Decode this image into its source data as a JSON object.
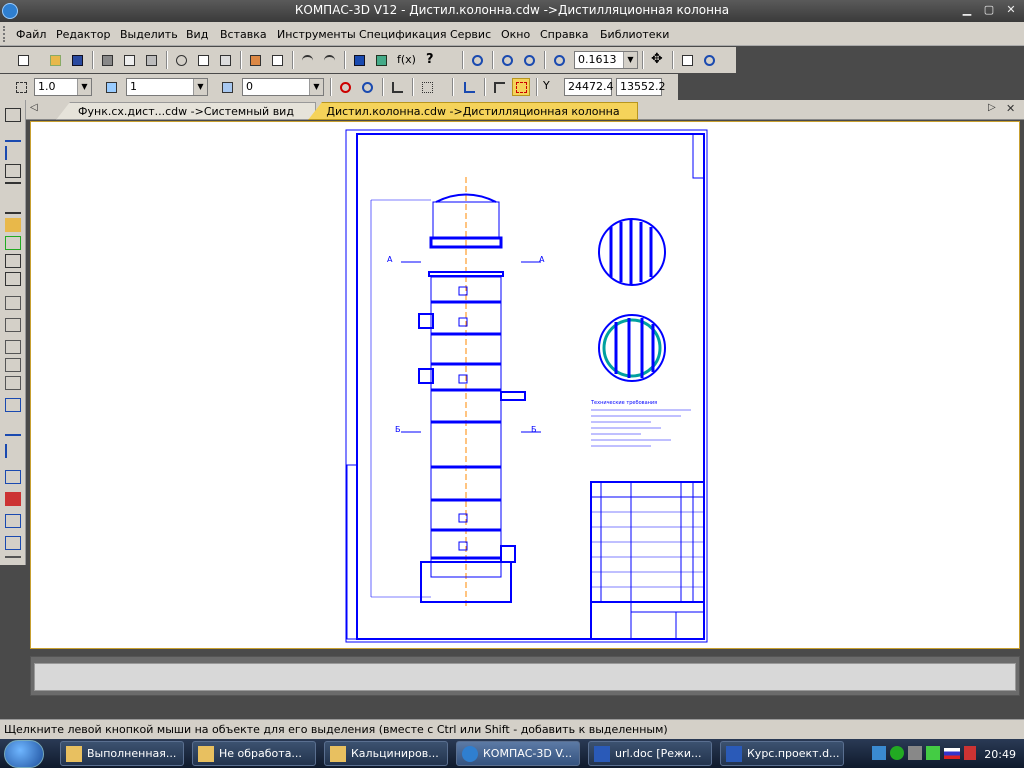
{
  "window": {
    "title": "КОМПАС-3D V12 - Дистил.колонна.cdw ->Дистилляционная колонна"
  },
  "menu": [
    "Файл",
    "Редактор",
    "Выделить",
    "Вид",
    "Вставка",
    "Инструменты",
    "Спецификация",
    "Сервис",
    "Окно",
    "Справка",
    "Библиотеки"
  ],
  "toolbar1": {
    "zoom_value": "0.1613"
  },
  "toolbar2": {
    "line_scale": "1.0",
    "layer_value": "1",
    "style_value": "0",
    "coord_x": "24472.4",
    "coord_y": "13552.2",
    "coord_label": "Y"
  },
  "tabs": [
    {
      "label": "Функ.сх.дист...cdw ->Системный вид",
      "active": false
    },
    {
      "label": "Дистил.колонна.cdw ->Дистилляционная колонна",
      "active": true
    }
  ],
  "drawing": {
    "section_labels": [
      "А",
      "А",
      "Б",
      "Б"
    ],
    "sheet_text": "Технические требования"
  },
  "status": {
    "hint": "Щелкните левой кнопкой мыши на объекте для его выделения (вместе с Ctrl или Shift - добавить к выделенным)"
  },
  "taskbar": {
    "items": [
      {
        "label": "Выполненная...",
        "icon": "folder-icon"
      },
      {
        "label": "Не обработа...",
        "icon": "folder-icon"
      },
      {
        "label": "Кальциниров...",
        "icon": "folder-icon"
      },
      {
        "label": "КОМПАС-3D V...",
        "icon": "kompas-icon"
      },
      {
        "label": "url.doc [Режи...",
        "icon": "word-icon"
      },
      {
        "label": "Курс.проект.d...",
        "icon": "word-icon"
      }
    ],
    "clock": "20:49"
  },
  "colors": {
    "drawing_line": "#0000ff",
    "tab_active": "#f5d35a",
    "chrome": "#d4d0c8"
  }
}
